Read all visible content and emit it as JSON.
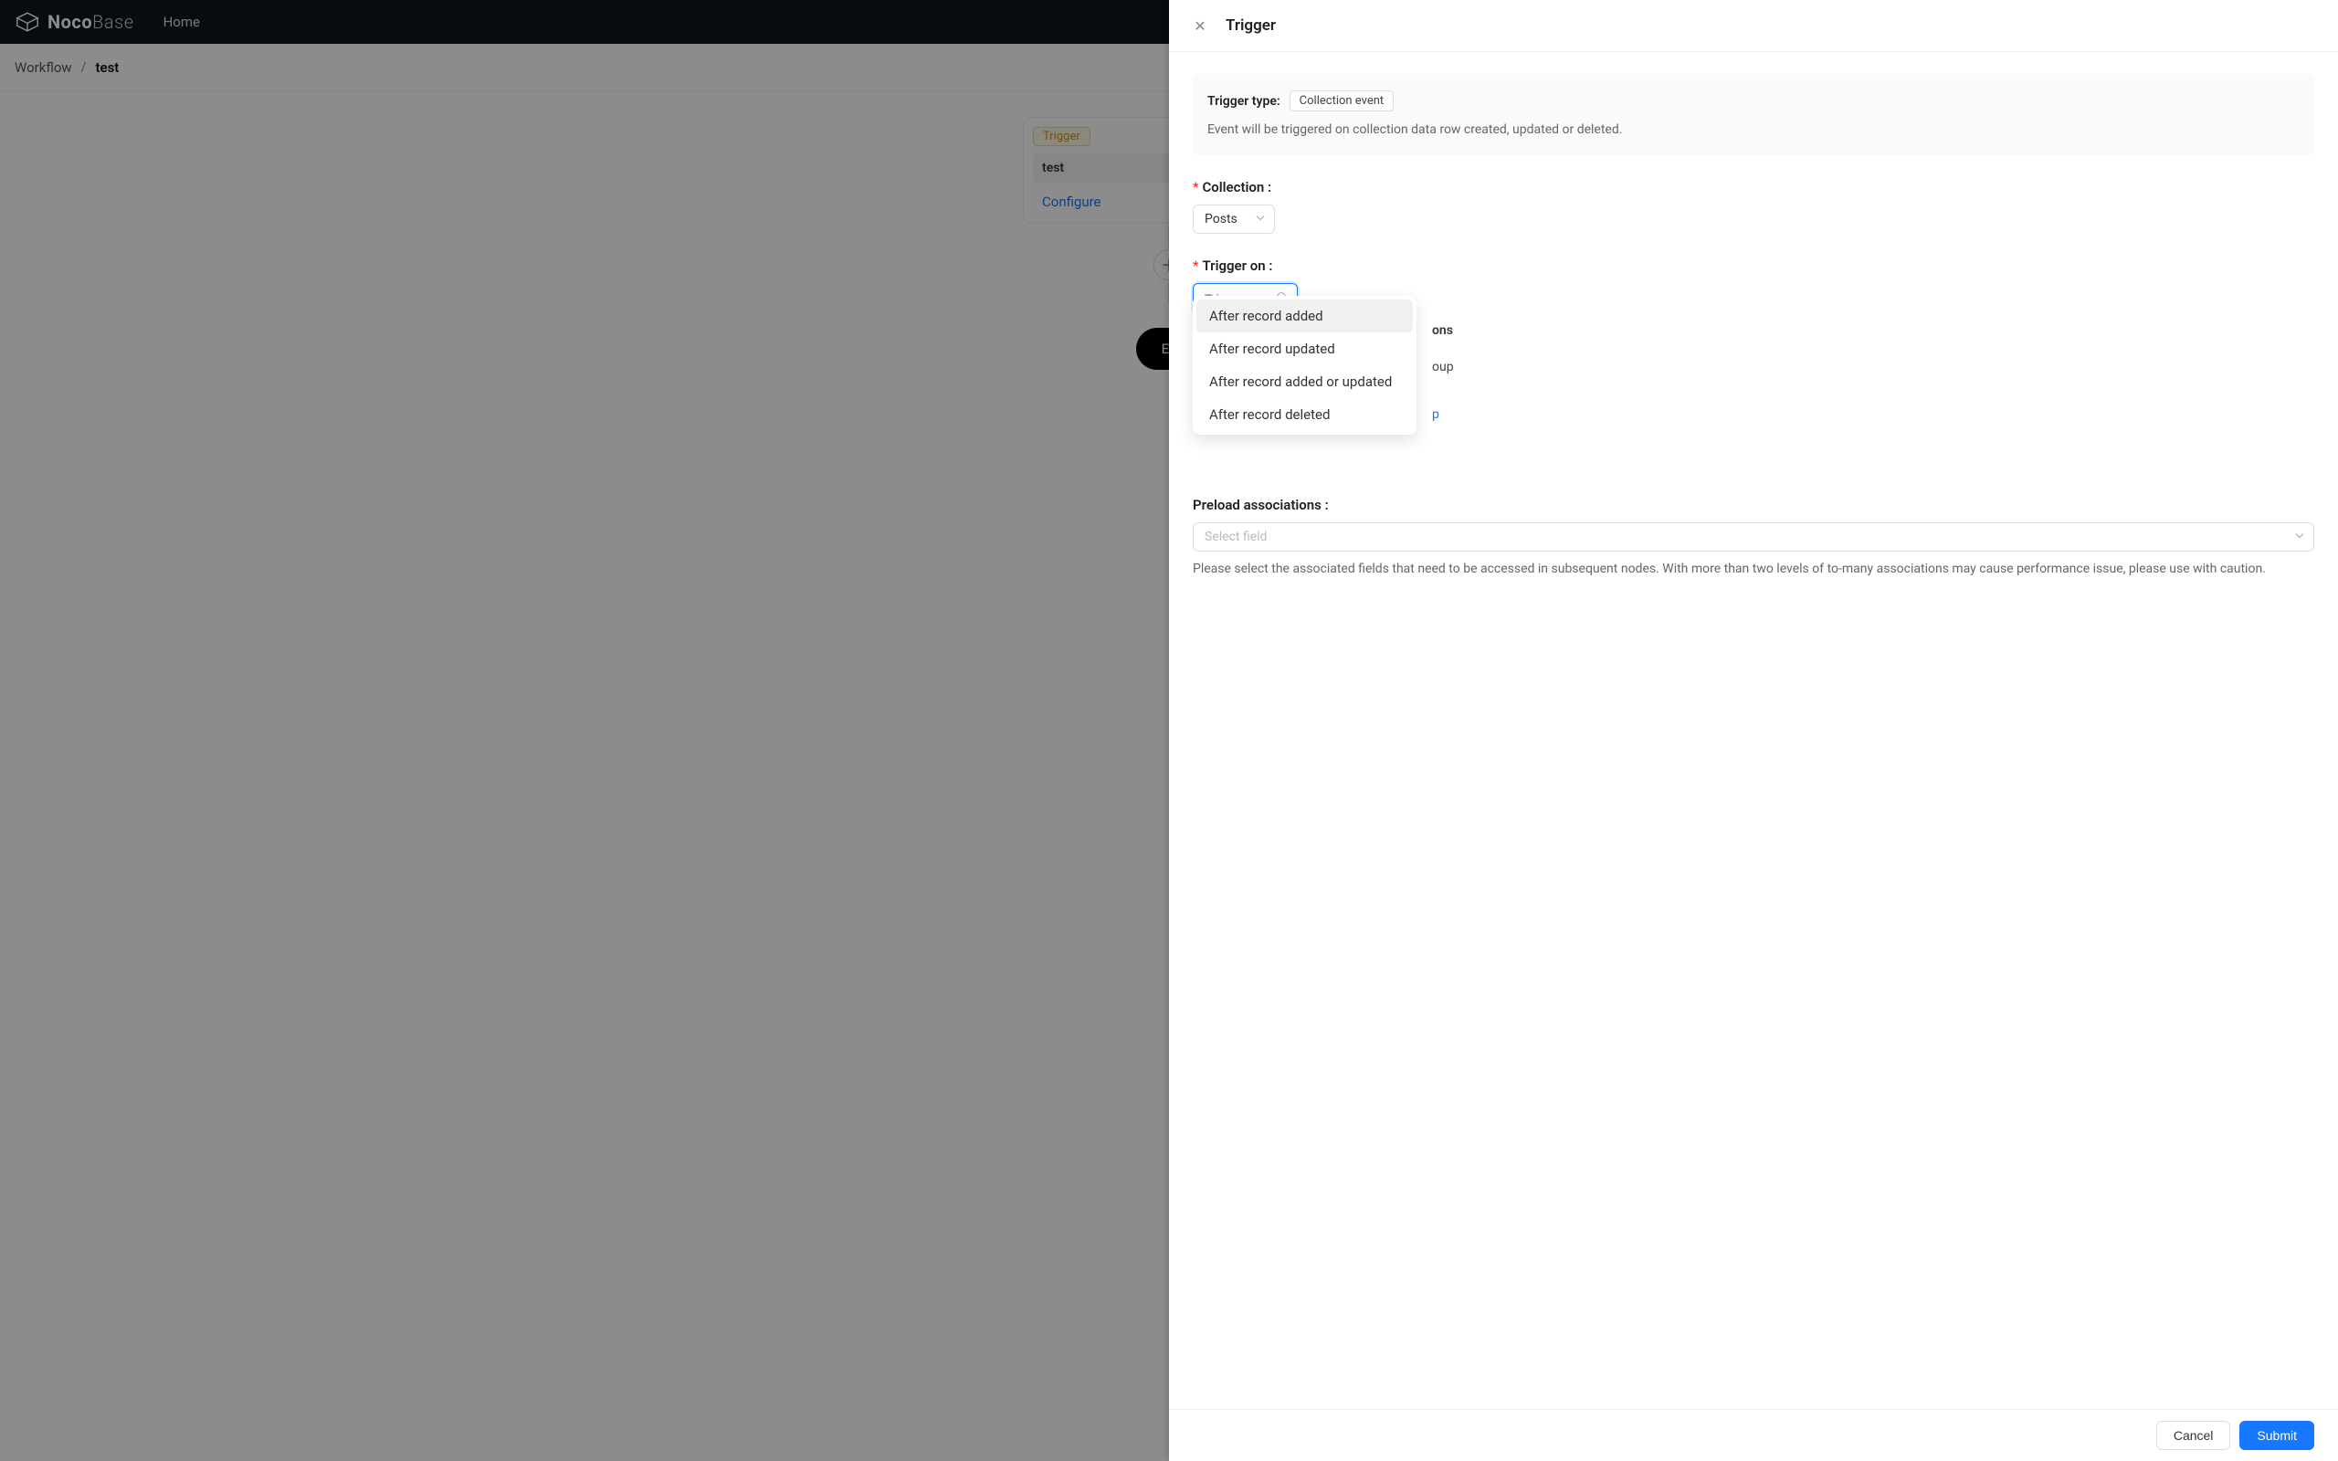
{
  "topnav": {
    "logo_bold": "Noco",
    "logo_light": "Base",
    "home": "Home"
  },
  "breadcrumb": {
    "root": "Workflow",
    "sep": "/",
    "current": "test"
  },
  "canvas": {
    "trigger_badge": "Trigger",
    "trigger_name": "test",
    "configure": "Configure",
    "end_visible": "En"
  },
  "drawer": {
    "title": "Trigger",
    "info": {
      "trigger_type_label": "Trigger type:",
      "trigger_type_value": "Collection event",
      "description": "Event will be triggered on collection data row created, updated or deleted."
    },
    "collection": {
      "label": "Collection",
      "value": "Posts"
    },
    "trigger_on": {
      "label": "Trigger on",
      "placeholder": "Trigger on",
      "options": [
        "After record added",
        "After record updated",
        "After record added or updated",
        "After record deleted"
      ],
      "partial_label_right": "ons",
      "partial_row2_right": "oup",
      "partial_link_right": "p"
    },
    "preload": {
      "label": "Preload associations",
      "placeholder": "Select field",
      "help": "Please select the associated fields that need to be accessed in subsequent nodes. With more than two levels of to-many associations may cause performance issue, please use with caution."
    },
    "footer": {
      "cancel": "Cancel",
      "submit": "Submit"
    }
  }
}
